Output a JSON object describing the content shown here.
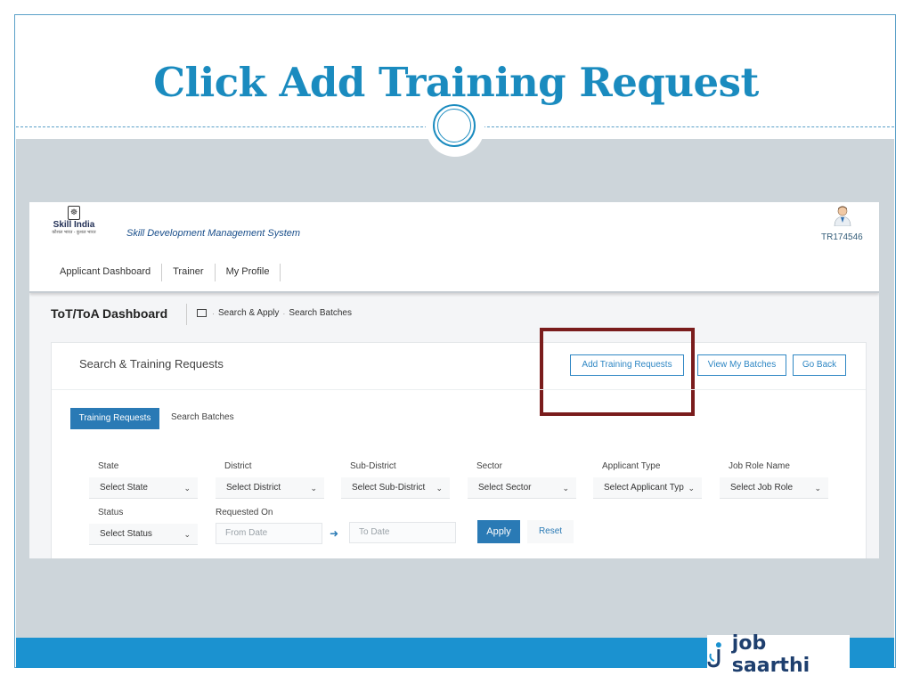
{
  "slide": {
    "title": "Click Add Training Request",
    "logo_text": "job saarthi",
    "accent": "#1a8bbf",
    "bar_color": "#1b92d0",
    "highlight_color": "#7a1c1c"
  },
  "app": {
    "brand_name": "Skill India",
    "brand_tagline": "कौशल भारत - कुशल भारत",
    "system_name": "Skill Development Management System",
    "user_id": "TR174546",
    "nav": [
      "Applicant Dashboard",
      "Trainer",
      "My Profile"
    ],
    "dashboard_title": "ToT/ToA Dashboard",
    "breadcrumb": [
      "Search & Apply",
      "Search Batches"
    ]
  },
  "card": {
    "title": "Search & Training Requests",
    "buttons": {
      "add": "Add Training Requests",
      "view": "View My Batches",
      "back": "Go Back"
    },
    "tabs": {
      "active": "Training Requests",
      "inactive": "Search Batches"
    }
  },
  "filters": {
    "state": {
      "label": "State",
      "value": "Select State"
    },
    "district": {
      "label": "District",
      "value": "Select District"
    },
    "sub_district": {
      "label": "Sub-District",
      "value": "Select Sub-District"
    },
    "sector": {
      "label": "Sector",
      "value": "Select Sector"
    },
    "applicant_type": {
      "label": "Applicant Type",
      "value": "Select Applicant Typ"
    },
    "job_role": {
      "label": "Job Role Name",
      "value": "Select Job Role"
    },
    "status": {
      "label": "Status",
      "value": "Select Status"
    },
    "requested_on": {
      "label": "Requested On",
      "from_placeholder": "From Date",
      "to_placeholder": "To Date"
    },
    "apply_label": "Apply",
    "reset_label": "Reset"
  }
}
